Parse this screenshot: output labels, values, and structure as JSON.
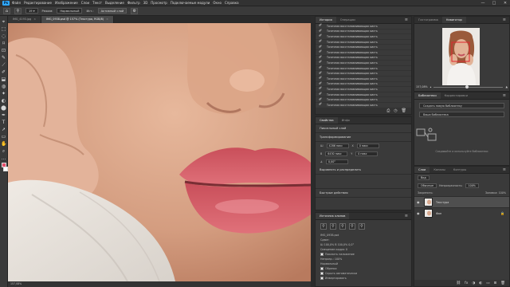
{
  "app": {
    "logo": "Ps"
  },
  "menu": [
    "Файл",
    "Редактирование",
    "Изображение",
    "Слои",
    "Текст",
    "Выделение",
    "Фильтр",
    "3D",
    "Просмотр",
    "Подключаемые модули",
    "Окно",
    "Справка"
  ],
  "window_controls": [
    "—",
    "□",
    "✕"
  ],
  "options": {
    "mode_label": "Режим:",
    "mode_value": "Нормальный",
    "source_label": "Ист.:",
    "sample_value": "Активный слой"
  },
  "tabs": [
    {
      "label": "IMG_4193.jpg",
      "active": false
    },
    {
      "label": "IMG_0938.psd @ 157% (Текстура, RGB/8)",
      "active": true
    }
  ],
  "toolbar": {
    "tools": [
      "⌖",
      "⬚",
      "◌",
      "⌑",
      "⊡",
      "✎",
      "⟋",
      "✐",
      "⬓",
      "◍",
      "✦",
      "◐",
      "⬤",
      "✒",
      "T",
      "➚",
      "▭",
      "✋",
      "⌕",
      "…"
    ],
    "fg_color": "#e64f6a",
    "bg_color": "#ffffff"
  },
  "statusbar": {
    "text": "157,08%"
  },
  "history": {
    "tabs": [
      "История",
      "Операции"
    ],
    "item_label": "Точечная восстанавливающая кисть",
    "item_count": 17,
    "selected_index": 16,
    "footer_icons": [
      "⎙",
      "◷",
      "🗑"
    ]
  },
  "properties": {
    "tabs": [
      "Свойства",
      "Инфо"
    ],
    "layer_type": "Пиксельный слой",
    "transform_heading": "Трансформирование",
    "w_value": "4286 пикс",
    "h_value": "6430 пикс",
    "x_value": "0 пикс",
    "y_value": "0 пикс",
    "angle_value": "0,00°",
    "align_heading": "Выровнять и распределить",
    "quick_heading": "Быстрые действия"
  },
  "clone": {
    "title": "Источник клонов",
    "file": "IMG_0938.psd",
    "offset_label": "Сдвиг:",
    "w_label": "Ш",
    "w_value": "100,0%",
    "h_label": "В",
    "h_value": "100,0%",
    "angle_value": "0,0°",
    "frame_label": "Смещение кадра:",
    "frame_value": "0",
    "opacity_label": "Непрозр.:",
    "opacity_value": "100%",
    "show_overlay": "Показать наложение",
    "normal_label": "Нормальный",
    "clipped_label": "Обрезка",
    "auto_hide": "Скрыть автоматически",
    "invert": "Инвертировать"
  },
  "navigator": {
    "tabs": [
      "Гистограмма",
      "Навигатор"
    ],
    "zoom_value": "157,08%",
    "zoom_fraction": 0.46
  },
  "libraries": {
    "tabs": [
      "Библиотеки",
      "Корректировки"
    ],
    "create_button": "Создать новую библиотеку",
    "search_placeholder": "Ваша библиотека",
    "hint": "Создавайте и используйте библиотеки"
  },
  "layers": {
    "tabs": [
      "Слои",
      "Каналы",
      "Контуры"
    ],
    "kind_label": "Вид",
    "blend_value": "Обычные",
    "opacity_label": "Непрозрачность:",
    "opacity_value": "100%",
    "lock_label": "Закрепить:",
    "fill_label": "Заливка:",
    "fill_value": "100%",
    "items": [
      {
        "name": "Текстура",
        "selected": true
      },
      {
        "name": "Фон",
        "selected": false
      }
    ],
    "footer_icons": [
      "⛓",
      "fx",
      "◑",
      "◐",
      "▭",
      "⊞",
      "🗑"
    ]
  }
}
